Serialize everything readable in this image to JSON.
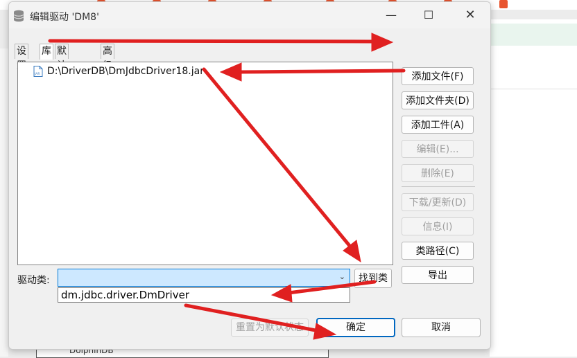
{
  "window": {
    "title": "编辑驱动 'DM8'",
    "title_icon": "database-icon",
    "minimize_icon": "minimize-icon",
    "maximize_icon": "maximize-icon",
    "close_icon": "close-icon",
    "minimize_glyph": "—",
    "maximize_glyph": "☐",
    "close_glyph": "✕"
  },
  "tabs": [
    {
      "label": "设置",
      "active": false
    },
    {
      "label": "库",
      "active": true
    },
    {
      "label": "默认属性",
      "active": false
    },
    {
      "label": "高级参数",
      "active": false
    }
  ],
  "library": {
    "items": [
      {
        "path": "D:\\DriverDB\\DmJdbcDriver18.jar",
        "icon": "jar-file-icon"
      }
    ]
  },
  "side_buttons": {
    "add_file": "添加文件(F)",
    "add_folder": "添加文件夹(D)",
    "add_artifact": "添加工件(A)",
    "edit": "编辑(E)...",
    "delete": "删除(E)",
    "download_update": "下载/更新(D)",
    "info": "信息(I)",
    "classpath": "类路径(C)",
    "export": "导出"
  },
  "driver_class": {
    "label": "驱动类:",
    "value": "",
    "find_button": "找到类",
    "dropdown_options": [
      "dm.jdbc.driver.DmDriver"
    ]
  },
  "footer": {
    "reset": "重置为默认状态",
    "ok": "确定",
    "cancel": "取消"
  },
  "background": {
    "bottom_text": "DolphinDB"
  },
  "colors": {
    "annotation_arrow": "#e02020",
    "combo_fill": "#cde8ff",
    "accent": "#0067c0"
  }
}
